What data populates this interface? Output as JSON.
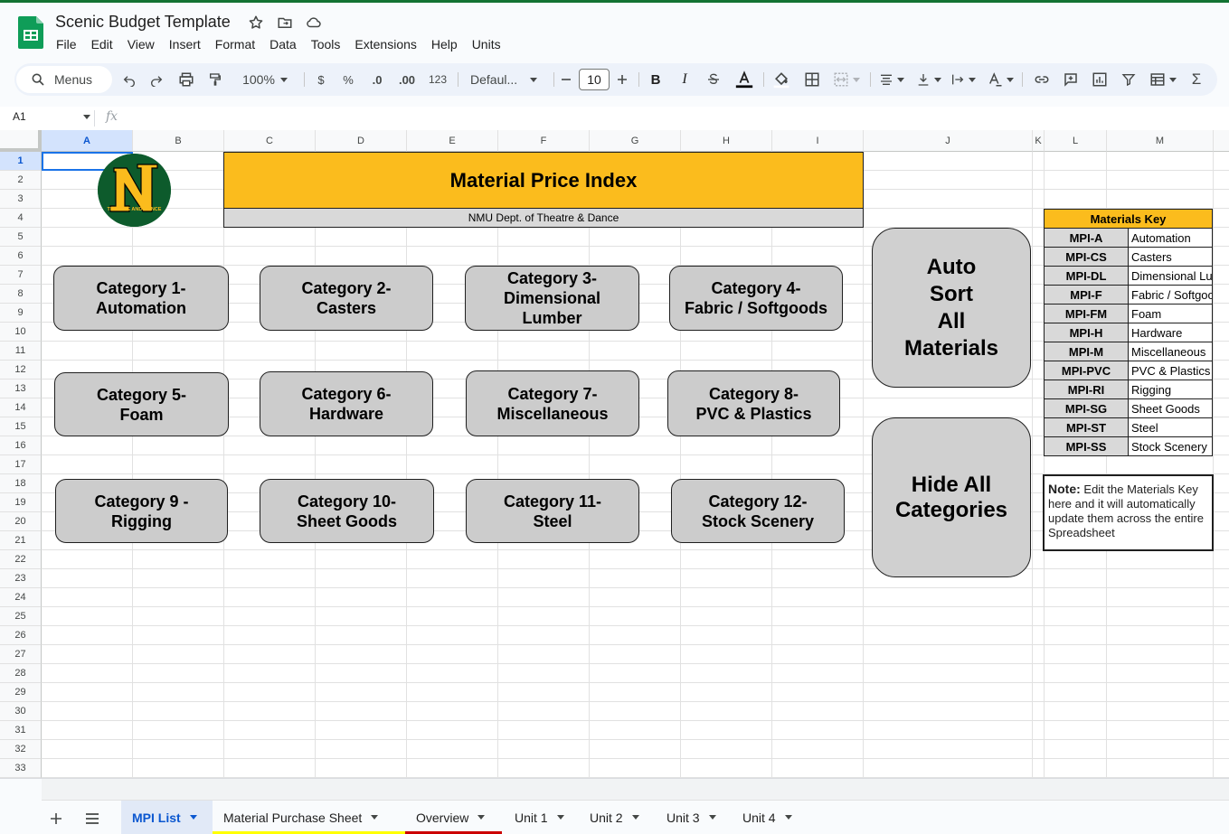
{
  "app": {
    "title": "Scenic Budget Template",
    "menu": [
      "File",
      "Edit",
      "View",
      "Insert",
      "Format",
      "Data",
      "Tools",
      "Extensions",
      "Help",
      "Units"
    ]
  },
  "toolbar": {
    "menus_label": "Menus",
    "zoom": "100%",
    "currency": "$",
    "percent": "%",
    "decrease_decimal": ".0",
    "increase_decimal": ".00",
    "number_format": "123",
    "font": "Defaul...",
    "font_size": "10"
  },
  "formula_bar": {
    "cell_ref": "A1",
    "fx": "fx"
  },
  "grid": {
    "columns": [
      "A",
      "B",
      "C",
      "D",
      "E",
      "F",
      "G",
      "H",
      "I",
      "J",
      "K",
      "L",
      "M"
    ],
    "rows": [
      "1",
      "2",
      "3",
      "4",
      "5",
      "6",
      "7",
      "8",
      "9",
      "10",
      "11",
      "12",
      "13",
      "14",
      "15",
      "16",
      "17",
      "18",
      "19",
      "20",
      "21",
      "22",
      "23",
      "24",
      "25",
      "26",
      "27",
      "28",
      "29",
      "30",
      "31",
      "32",
      "33"
    ],
    "selected_column": "A",
    "selected_row": "1"
  },
  "sheet": {
    "banner_title": "Material Price Index",
    "banner_subtitle": "NMU Dept. of Theatre & Dance",
    "logo_text": "THEATRE AND DANCE",
    "logo_letter": "N",
    "categories": [
      [
        "Category 1-",
        "Automation"
      ],
      [
        "Category 2-",
        "Casters"
      ],
      [
        "Category 3-",
        "Dimensional",
        "Lumber"
      ],
      [
        "Category 4-",
        "Fabric / Softgoods"
      ],
      [
        "Category 5-",
        "Foam"
      ],
      [
        "Category 6-",
        "Hardware"
      ],
      [
        "Category 7-",
        "Miscellaneous"
      ],
      [
        "Category 8-",
        "PVC & Plastics"
      ],
      [
        "Category 9 -",
        "Rigging"
      ],
      [
        "Category 10-",
        "Sheet Goods"
      ],
      [
        "Category 11-",
        "Steel"
      ],
      [
        "Category 12-",
        "Stock Scenery"
      ]
    ],
    "auto_sort_button": [
      "Auto",
      "Sort",
      "All",
      "Materials"
    ],
    "hide_button": [
      "Hide All",
      "Categories"
    ],
    "key": {
      "title": "Materials Key",
      "items": [
        {
          "code": "MPI-A",
          "name": "Automation"
        },
        {
          "code": "MPI-CS",
          "name": "Casters"
        },
        {
          "code": "MPI-DL",
          "name": "Dimensional Lumbe"
        },
        {
          "code": "MPI-F",
          "name": "Fabric / Softgoods"
        },
        {
          "code": "MPI-FM",
          "name": "Foam"
        },
        {
          "code": "MPI-H",
          "name": "Hardware"
        },
        {
          "code": "MPI-M",
          "name": "Miscellaneous"
        },
        {
          "code": "MPI-PVC",
          "name": "PVC & Plastics"
        },
        {
          "code": "MPI-RI",
          "name": "Rigging"
        },
        {
          "code": "MPI-SG",
          "name": "Sheet Goods"
        },
        {
          "code": "MPI-ST",
          "name": "Steel"
        },
        {
          "code": "MPI-SS",
          "name": "Stock Scenery"
        }
      ]
    },
    "note": {
      "label": "Note:",
      "text": " Edit the Materials Key here and it will automatically update them across the entire Spreadsheet"
    }
  },
  "tabs": [
    {
      "label": "MPI List",
      "active": true,
      "color": ""
    },
    {
      "label": "Material Purchase Sheet",
      "active": false,
      "color": "#ffff00"
    },
    {
      "label": "Overview",
      "active": false,
      "color": "#cc0000"
    },
    {
      "label": "Unit 1",
      "active": false,
      "color": ""
    },
    {
      "label": "Unit 2",
      "active": false,
      "color": ""
    },
    {
      "label": "Unit 3",
      "active": false,
      "color": ""
    },
    {
      "label": "Unit 4",
      "active": false,
      "color": ""
    }
  ],
  "colors": {
    "banner": "#fbbc1d",
    "button_gray": "#cccccc",
    "logo_green": "#0d5b2c",
    "logo_gold": "#fbbc1d",
    "active_tab": "#0b57d0"
  }
}
